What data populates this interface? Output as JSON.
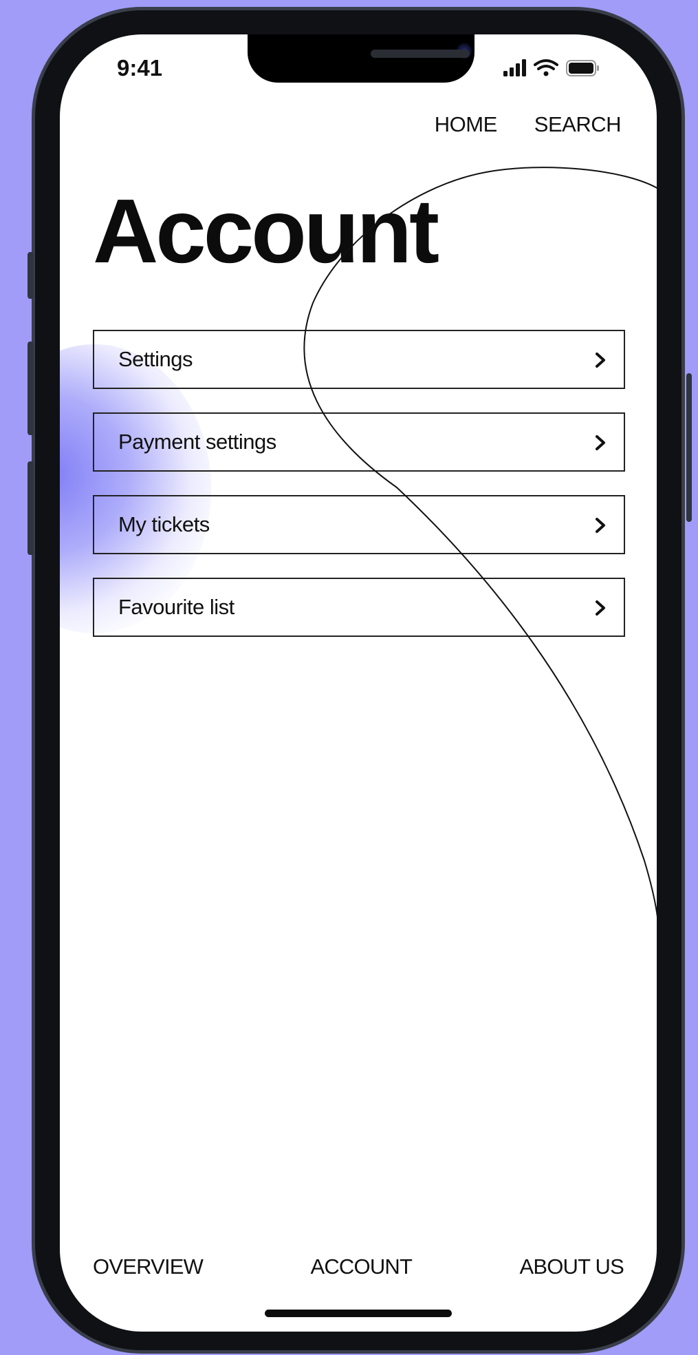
{
  "status_bar": {
    "time": "9:41",
    "signal_icon": "cellular-signal-icon",
    "wifi_icon": "wifi-icon",
    "battery_icon": "battery-icon"
  },
  "top_nav": {
    "home": "HOME",
    "search": "SEARCH"
  },
  "page": {
    "title": "Account"
  },
  "menu": {
    "items": [
      {
        "label": "Settings",
        "icon": "chevron-right-icon"
      },
      {
        "label": "Payment settings",
        "icon": "chevron-right-icon"
      },
      {
        "label": "My tickets",
        "icon": "chevron-right-icon"
      },
      {
        "label": "Favourite list",
        "icon": "chevron-right-icon"
      }
    ]
  },
  "bottom_nav": {
    "overview": "OVERVIEW",
    "account": "ACCOUNT",
    "about_us": "ABOUT US"
  },
  "colors": {
    "background": "#a09cf8",
    "accent_glow": "#7876f5",
    "text": "#111111",
    "screen": "#ffffff"
  }
}
